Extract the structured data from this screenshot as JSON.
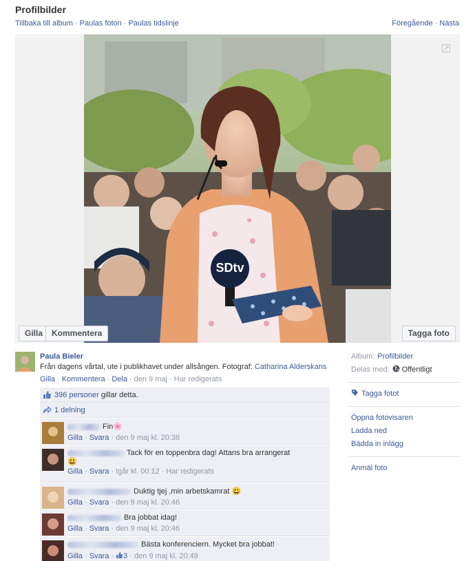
{
  "header": {
    "title": "Profilbilder",
    "crumbs": [
      "Tillbaka till album",
      "Paulas foton",
      "Paulas tidslinje"
    ],
    "prev": "Föregående",
    "next": "Nästa"
  },
  "stage": {
    "like_button": "Gilla",
    "comment_button": "Kommentera",
    "tag_button": "Tagga foto",
    "expand_icon": "expand-icon",
    "microphone_logo": "SDtv"
  },
  "post": {
    "author": "Paula Bieler",
    "caption_text": "Från dagens vårtal, ute i publikhavet under allsången. Fotograf: ",
    "photographer": "Catharina Alderskans",
    "actions": {
      "like": "Gilla",
      "comment": "Kommentera",
      "share": "Dela",
      "time": "den 9 maj",
      "edited": "Har redigerats"
    },
    "likes_count": "396 personer",
    "likes_suffix": "gillar detta.",
    "shares": "1 delning"
  },
  "comments": [
    {
      "text": "Fin",
      "emoji": "🌸",
      "like": "Gilla",
      "reply": "Svara",
      "time": "den 9 maj kl. 20:38",
      "extra": ""
    },
    {
      "text": "Tack för en toppenbra dag! Attans bra arrangerat",
      "emoji": "😃",
      "like": "Gilla",
      "reply": "Svara",
      "time": "Igår kl. 00:12",
      "extra": "Har redigerats"
    },
    {
      "text": "Duktig tjej ,min arbetskamrat",
      "emoji": "😃",
      "like": "Gilla",
      "reply": "Svara",
      "time": "den 9 maj kl. 20:46",
      "extra": ""
    },
    {
      "text": "Bra jobbat idag!",
      "emoji": "",
      "like": "Gilla",
      "reply": "Svara",
      "time": "den 9 maj kl. 20:46",
      "extra": ""
    },
    {
      "text": "Bästa konferenciern. Mycket bra jobbat!",
      "emoji": "",
      "like": "Gilla",
      "reply": "Svara",
      "likes": "3",
      "time": "den 9 maj kl. 20:49",
      "extra": ""
    }
  ],
  "sidebar": {
    "album_label": "Album:",
    "album_value": "Profilbilder",
    "shared_label": "Delas med:",
    "shared_value": "Offentligt",
    "tag_photo": "Tagga fotot",
    "open_viewer": "Öppna fotovisaren",
    "download": "Ladda ned",
    "embed": "Bädda in inlägg",
    "report": "Anmäl foto"
  }
}
